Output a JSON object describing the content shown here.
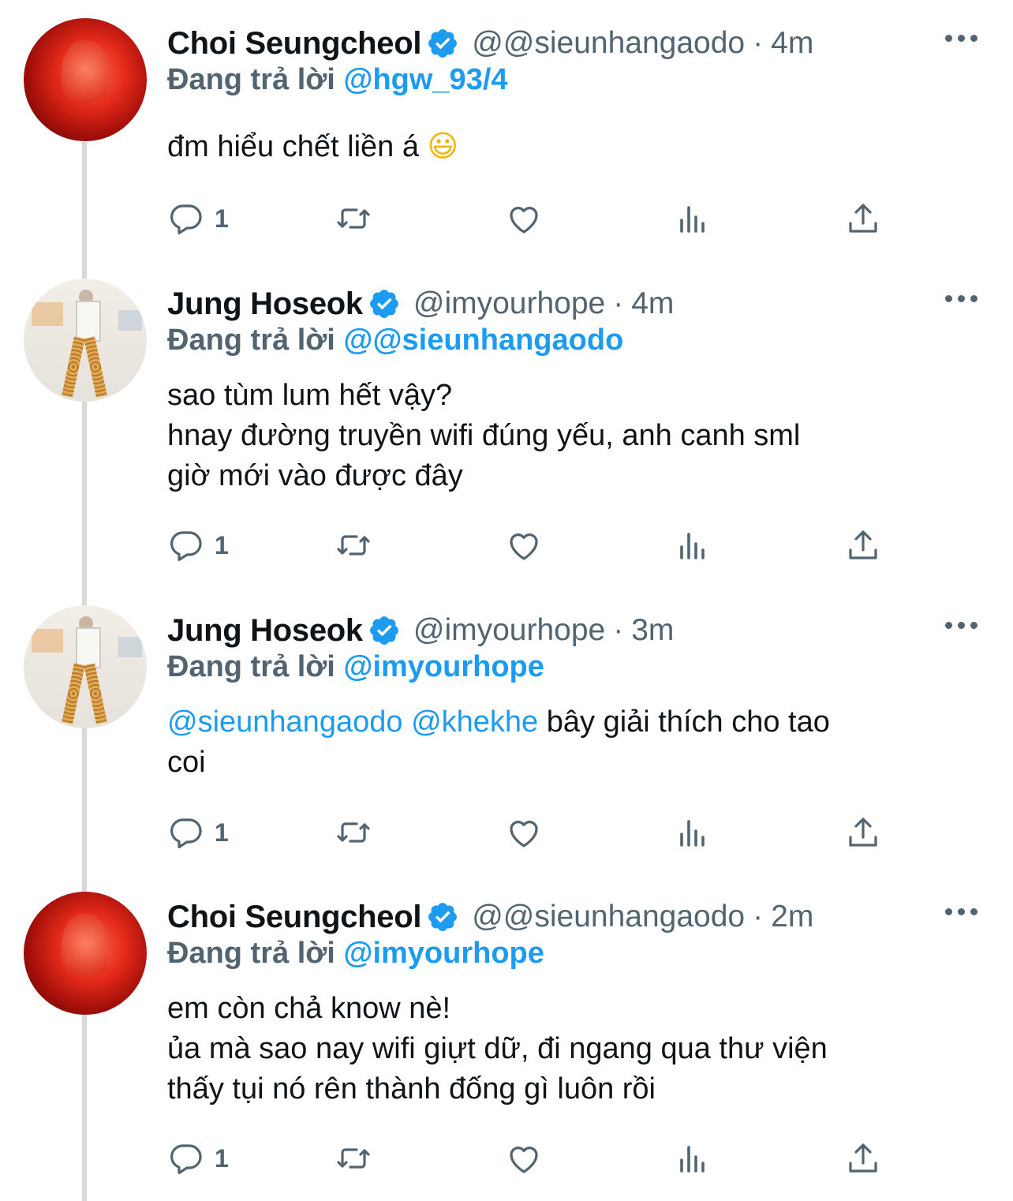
{
  "reply_prefix": "Đang trả lời",
  "tweets": [
    {
      "name": "Choi Seungcheol",
      "handle": "@@sieunhangaodo",
      "separator": "·",
      "time": "4m",
      "reply_to": "@hgw_93/4",
      "body": {
        "line1": "đm hiểu chết liền á",
        "emoji": "😃"
      },
      "reply_count": "1"
    },
    {
      "name": "Jung Hoseok",
      "handle": "@imyourhope",
      "separator": "·",
      "time": "4m",
      "reply_to": "@@sieunhangaodo",
      "body": {
        "line1": "sao tùm lum hết vậy?",
        "line2": "hnay đường truyền wifi đúng yếu, anh canh sml",
        "line3": "giờ mới vào được đây"
      },
      "reply_count": "1"
    },
    {
      "name": "Jung Hoseok",
      "handle": "@imyourhope",
      "separator": "·",
      "time": "3m",
      "reply_to": "@imyourhope",
      "body": {
        "mention1": "@sieunhangaodo",
        "mention2": "@khekhe",
        "text1": "bây giải thích cho tao",
        "text2": "coi"
      },
      "reply_count": "1"
    },
    {
      "name": "Choi Seungcheol",
      "handle": "@@sieunhangaodo",
      "separator": "·",
      "time": "2m",
      "reply_to": "@imyourhope",
      "body": {
        "line1": "em còn chả know nè!",
        "line2": "ủa mà sao nay wifi giựt dữ, đi ngang qua thư viện",
        "line3": "thấy tụi nó rên thành đống gì luôn rồi"
      },
      "reply_count": "1"
    }
  ],
  "colors": {
    "accent": "#1d9bf0",
    "secondary_text": "#536471",
    "thread_line": "#d9d9d9"
  },
  "icons": [
    "verified-icon",
    "more-icon",
    "reply-icon",
    "retweet-icon",
    "like-icon",
    "views-icon",
    "share-icon"
  ]
}
